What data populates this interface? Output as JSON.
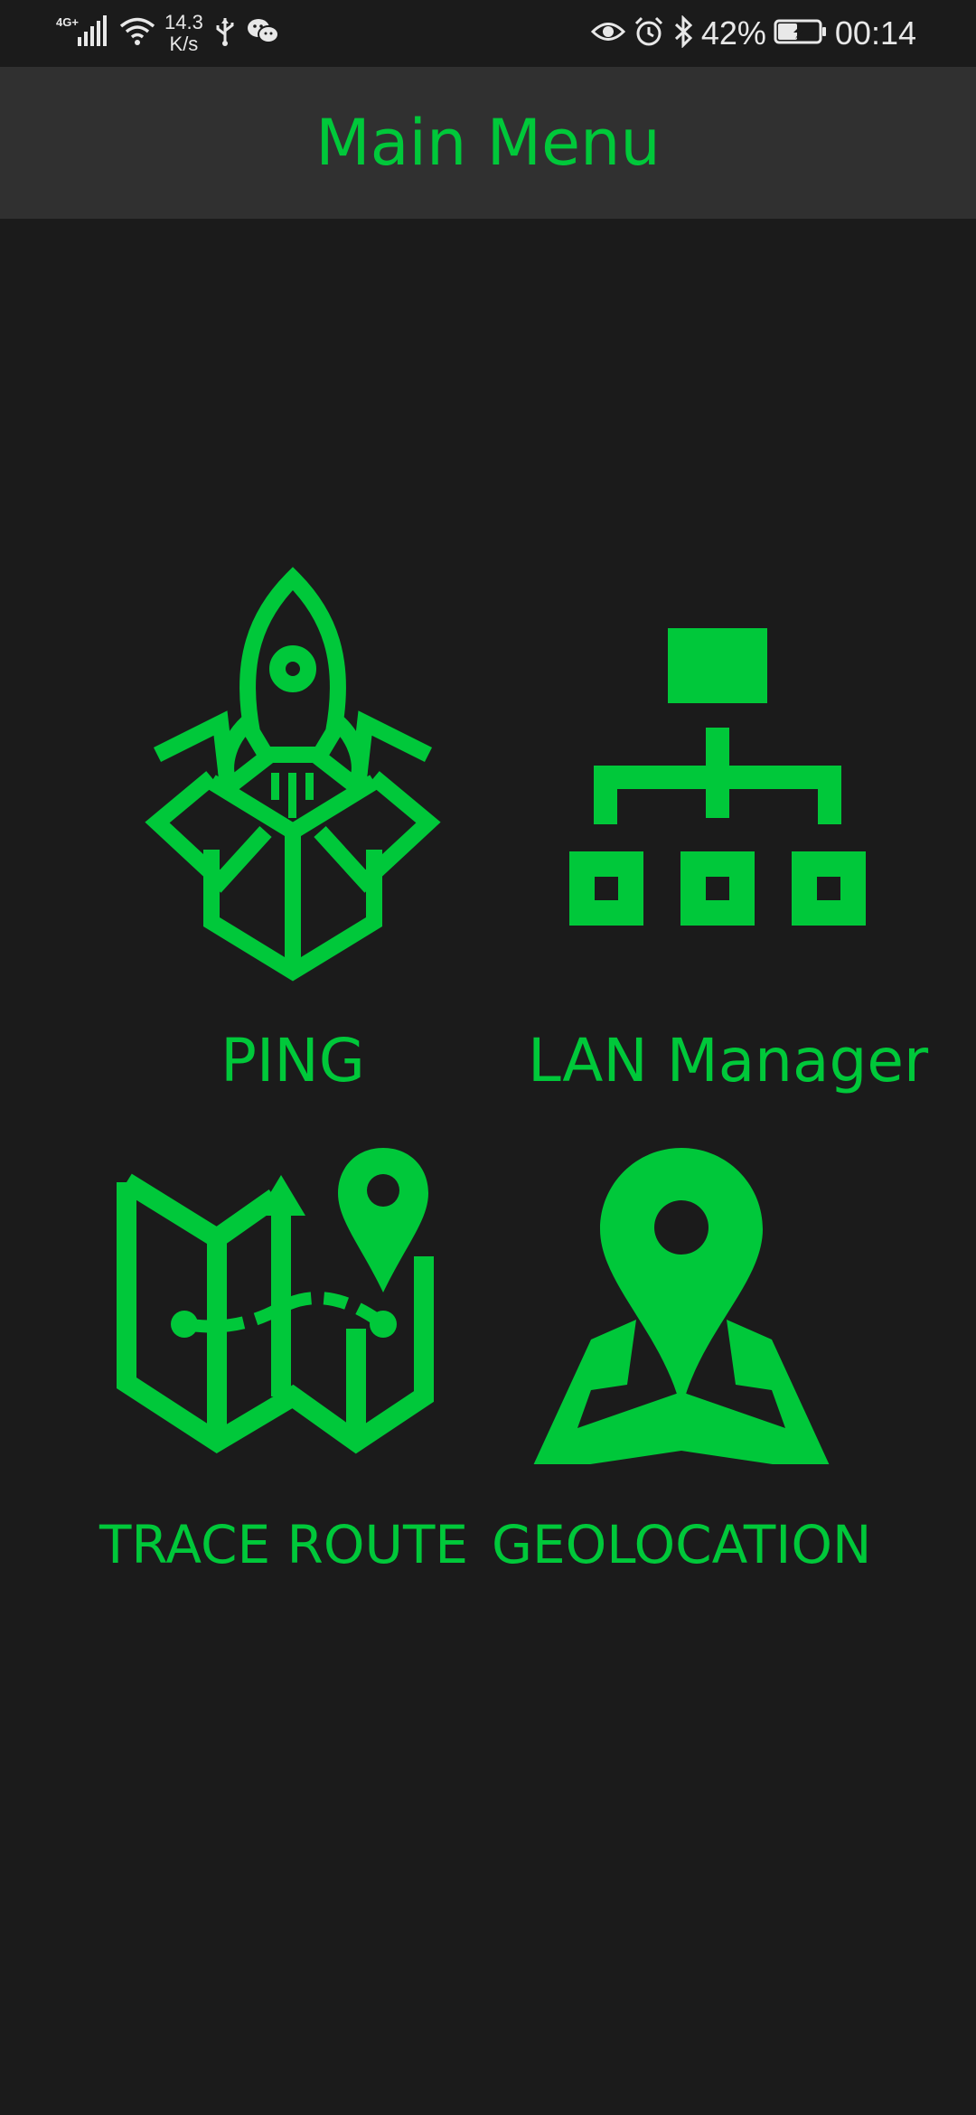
{
  "status_bar": {
    "network_type": "4G+",
    "speed_value": "14.3",
    "speed_unit": "K/s",
    "battery_percent": "42%",
    "time": "00:14",
    "icons": [
      "signal-icon",
      "wifi-icon",
      "usb-icon",
      "wechat-icon",
      "eye-icon",
      "alarm-icon",
      "bluetooth-icon",
      "battery-icon"
    ]
  },
  "app_bar": {
    "title": "Main Menu"
  },
  "menu": {
    "ping": {
      "label": "PING",
      "icon": "rocket-box-icon"
    },
    "lan": {
      "label": "LAN Manager",
      "icon": "network-hierarchy-icon"
    },
    "trace": {
      "label": "TRACE ROUTE",
      "icon": "map-route-icon"
    },
    "geo": {
      "label": "GEOLOCATION",
      "icon": "location-pin-map-icon"
    }
  },
  "colors": {
    "accent": "#00c83a",
    "background": "#1b1b1b",
    "app_bar": "#303030"
  }
}
